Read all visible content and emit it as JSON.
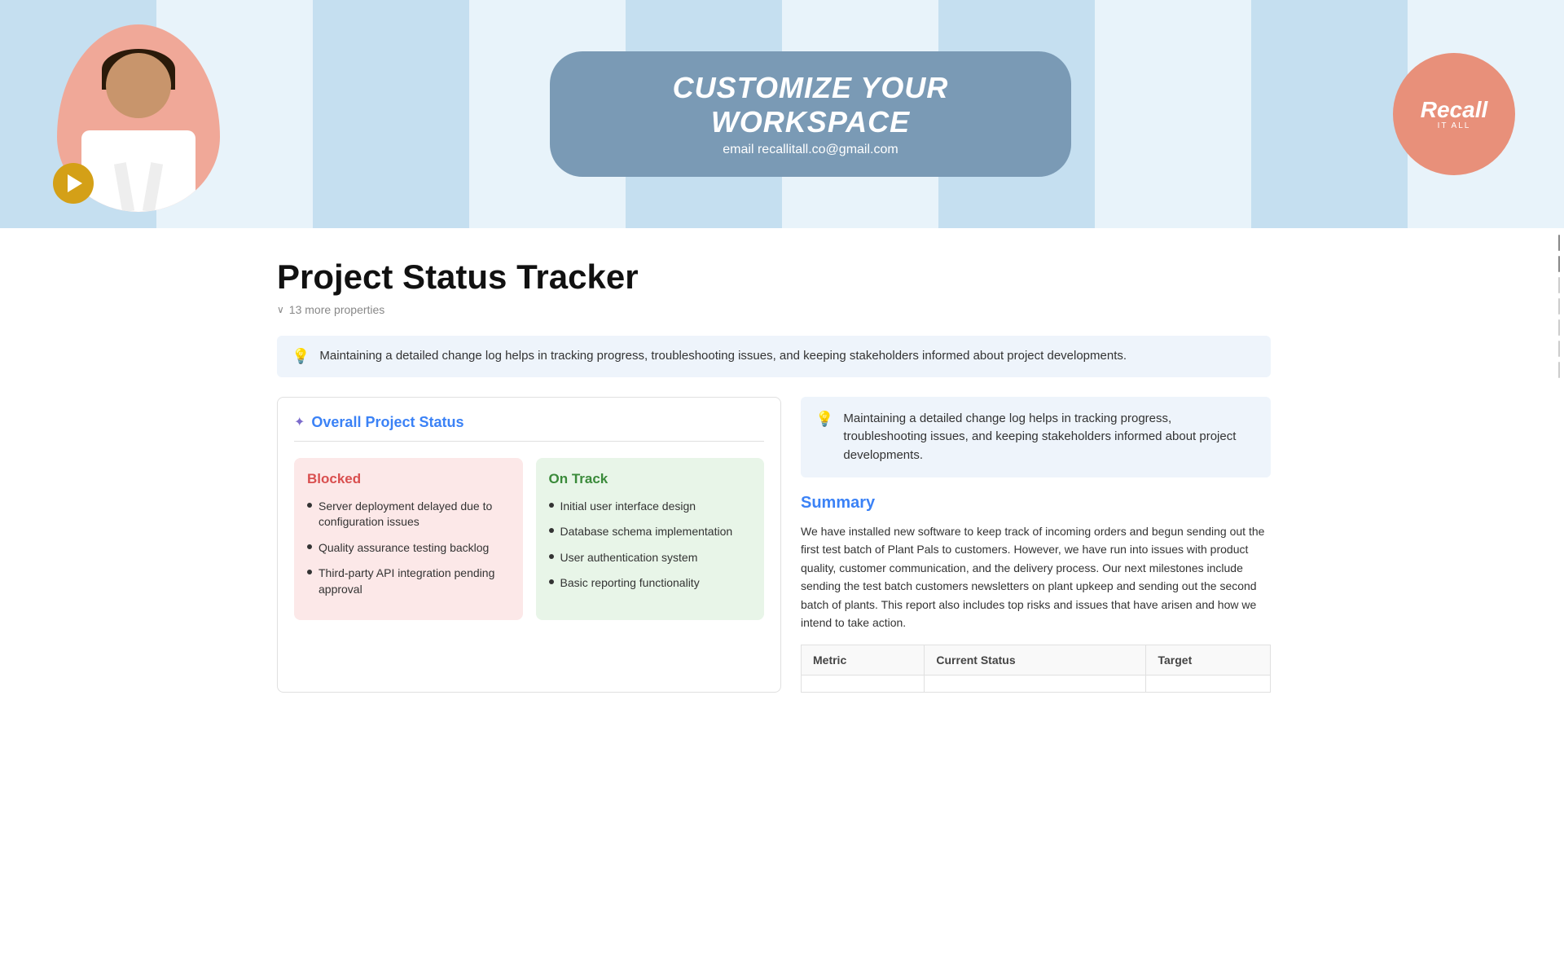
{
  "banner": {
    "customize_title": "CUSTOMIZE YOUR WORKSPACE",
    "customize_email": "email recallitall.co@gmail.com",
    "logo_main": "Recall",
    "logo_sub": "IT ALL"
  },
  "page": {
    "title": "Project Status Tracker",
    "properties_toggle": "13 more properties"
  },
  "callout_top": {
    "icon": "💡",
    "text": "Maintaining a detailed change log helps in tracking progress, troubleshooting issues, and keeping stakeholders informed about project developments."
  },
  "overall_status": {
    "panel_title": "Overall Project Status",
    "blocked": {
      "title": "Blocked",
      "items": [
        "Server deployment delayed due to configuration issues",
        "Quality assurance testing backlog",
        "Third-party API integration pending approval"
      ]
    },
    "on_track": {
      "title": "On Track",
      "items": [
        "Initial user interface design",
        "Database schema implementation",
        "User authentication system",
        "Basic reporting functionality"
      ]
    }
  },
  "right_panel": {
    "callout": {
      "icon": "💡",
      "text": "Maintaining a detailed change log helps in tracking progress, troubleshooting issues, and keeping stakeholders informed about project developments."
    },
    "summary": {
      "title": "Summary",
      "text": "We have installed new software to keep track of incoming orders and begun sending out the first test batch of Plant Pals to customers. However, we have run into issues with product quality, customer communication, and the delivery process. Our next milestones include sending the test batch customers newsletters on plant upkeep and sending out the second batch of plants. This report also includes top risks and issues that have arisen and how we intend to take action."
    },
    "table": {
      "headers": [
        "Metric",
        "Current Status",
        "Target"
      ],
      "rows": []
    }
  }
}
